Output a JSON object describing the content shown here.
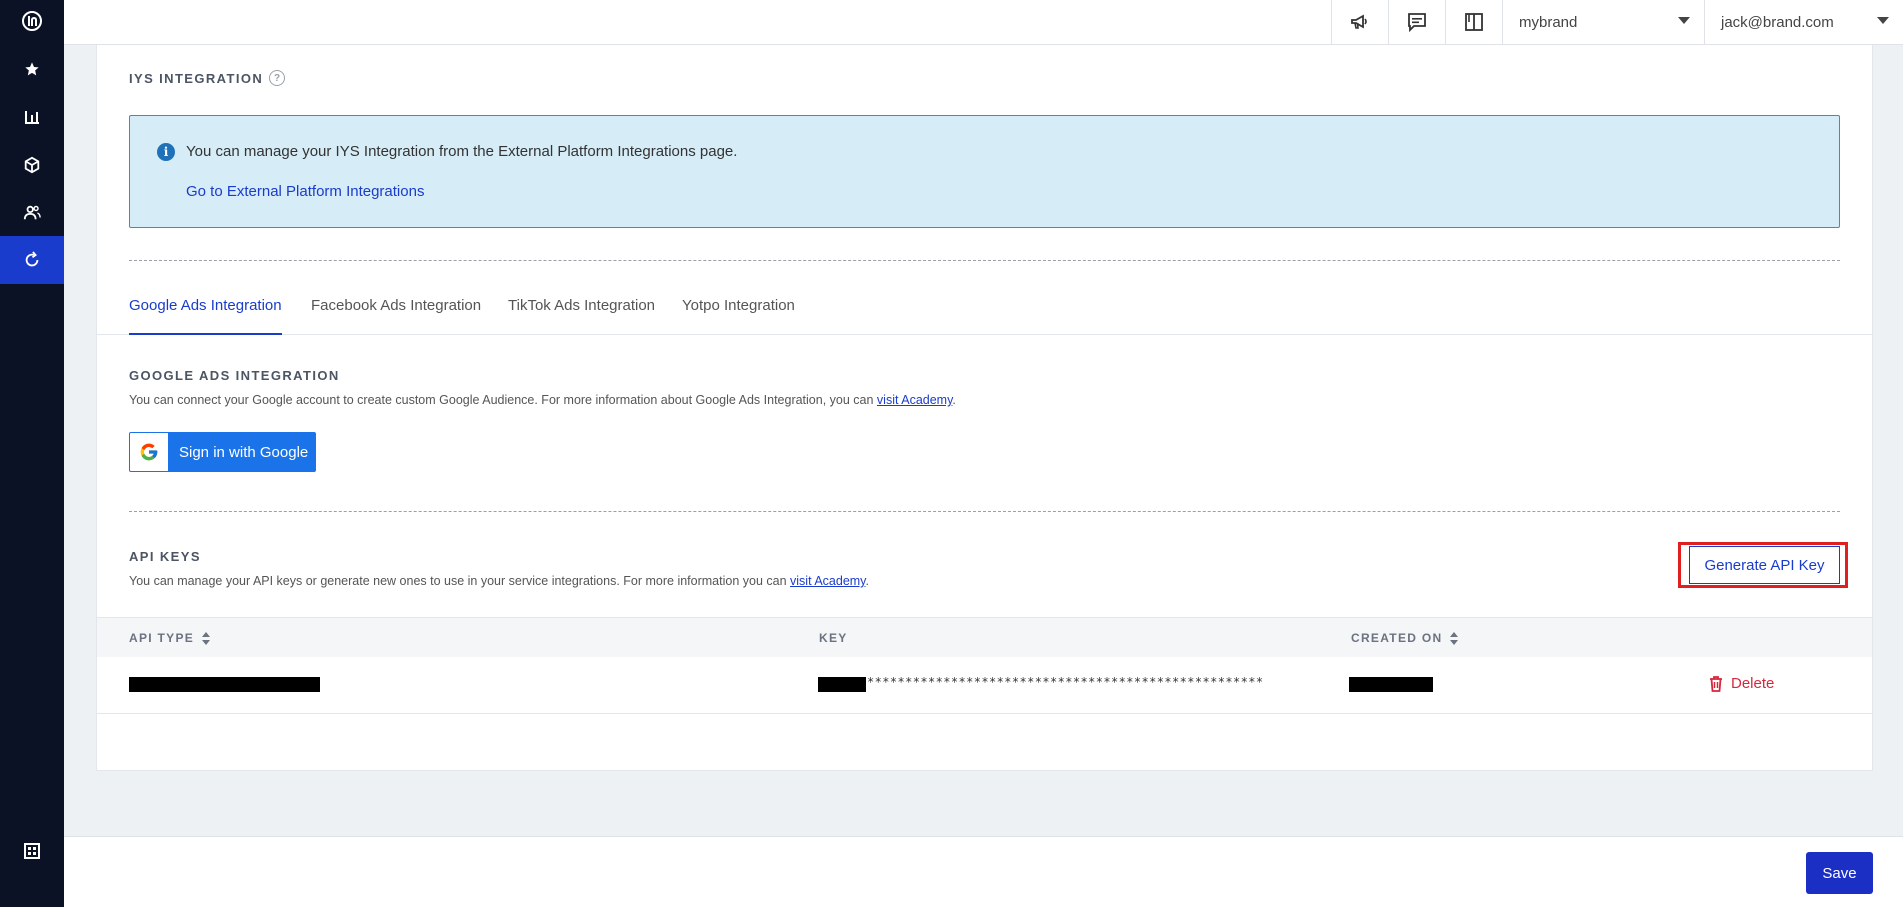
{
  "sidebar": {
    "icons": [
      "insider-logo-icon",
      "star-icon",
      "bar-chart-icon",
      "cube-icon",
      "users-icon",
      "refresh-icon",
      "apps-grid-icon"
    ]
  },
  "topbar": {
    "icons": [
      "megaphone-icon",
      "chat-icon",
      "book-icon"
    ],
    "brand_select": "mybrand",
    "user_select": "jack@brand.com"
  },
  "iys": {
    "title": "IYS INTEGRATION",
    "help": "?",
    "info_text": "You can manage your IYS Integration from the External Platform Integrations page.",
    "info_link": "Go to External Platform Integrations"
  },
  "tabs": [
    {
      "label": "Google Ads Integration",
      "active": true
    },
    {
      "label": "Facebook Ads Integration",
      "active": false
    },
    {
      "label": "TikTok Ads Integration",
      "active": false
    },
    {
      "label": "Yotpo Integration",
      "active": false
    }
  ],
  "google_ads": {
    "title": "GOOGLE ADS INTEGRATION",
    "desc_prefix": "You can connect your Google account to create custom Google Audience. For more information about Google Ads Integration, you can ",
    "desc_link": "visit Academy",
    "desc_suffix": ".",
    "signin_label": "Sign in with Google"
  },
  "api_keys": {
    "title": "API KEYS",
    "desc_prefix": "You can manage your API keys or generate new ones to use in your service integrations. For more information you can ",
    "desc_link": "visit Academy",
    "desc_suffix": ".",
    "generate_label": "Generate API Key",
    "columns": [
      "API TYPE",
      "KEY",
      "CREATED ON"
    ],
    "rows": [
      {
        "key_mask": "****************************************************",
        "delete_label": "Delete"
      }
    ]
  },
  "footer": {
    "save_label": "Save"
  },
  "colors": {
    "accent": "#1a3ccc",
    "sidebar_bg": "#0b1226",
    "danger": "#d7263d",
    "info_bg": "#d6ecf7",
    "highlight": "#e0201f"
  }
}
